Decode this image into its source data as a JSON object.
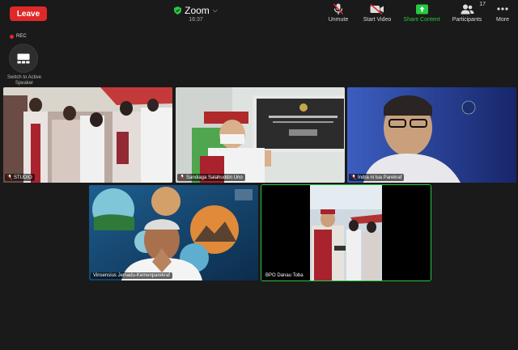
{
  "header": {
    "leave_label": "Leave",
    "app_title": "Zoom",
    "timer": "16:37"
  },
  "toolbar": {
    "unmute_label": "Unmute",
    "start_video_label": "Start Video",
    "share_label": "Share Content",
    "participants_label": "Participants",
    "participants_count": "17",
    "more_label": "More"
  },
  "recording": {
    "label": "REC"
  },
  "view": {
    "switch_label": "Switch to Active Speaker"
  },
  "participants": [
    {
      "name": "STUDIO"
    },
    {
      "name": "Sandiaga Salahuddin Uno"
    },
    {
      "name": "Indra ni tua Parekraf"
    },
    {
      "name": "Vinsensius Jemadu-Kemenparekraf"
    },
    {
      "name": "BPO Danau Toba"
    }
  ],
  "colors": {
    "leave": "#e02828",
    "share": "#27c93f",
    "active_speaker": "#27c93f",
    "background": "#1a1a1a"
  }
}
